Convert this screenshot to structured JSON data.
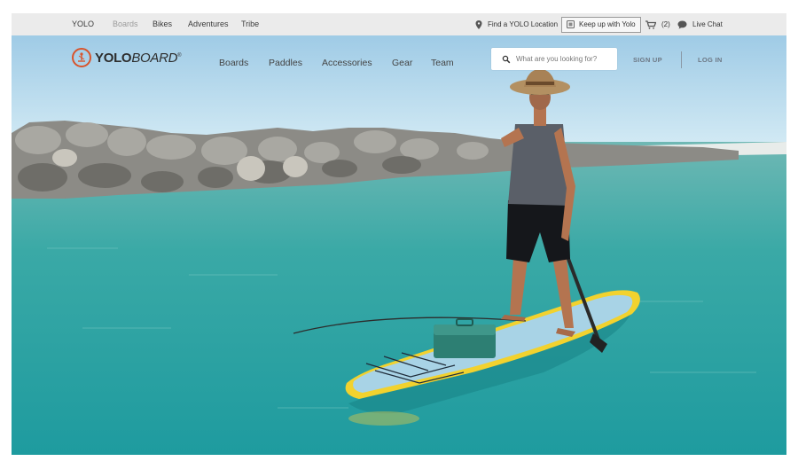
{
  "topbar": {
    "nav": [
      {
        "label": "YOLO"
      },
      {
        "label": "Boards"
      },
      {
        "label": "Bikes"
      },
      {
        "label": "Adventures"
      },
      {
        "label": "Tribe"
      }
    ],
    "location_label": "Find a YOLO Location",
    "keepup_label": "Keep up with Yolo",
    "cart_count": "(2)",
    "chat_label": "Live Chat"
  },
  "header": {
    "logo": {
      "bold": "YOLO",
      "italic": "BOARD",
      "mark": "®"
    },
    "nav": [
      {
        "label": "Boards"
      },
      {
        "label": "Paddles"
      },
      {
        "label": "Accessories"
      },
      {
        "label": "Gear"
      },
      {
        "label": "Team"
      }
    ],
    "search_placeholder": "What are you looking for?",
    "signup_label": "SIGN UP",
    "login_label": "LOG IN"
  },
  "colors": {
    "accent": "#d8542c",
    "water": "#2fa9a3",
    "board": "#f2d22e"
  },
  "icons": [
    "location-pin-icon",
    "keep-up-icon",
    "cart-icon",
    "chat-bubble-icon",
    "search-icon",
    "paddler-logo-icon"
  ]
}
